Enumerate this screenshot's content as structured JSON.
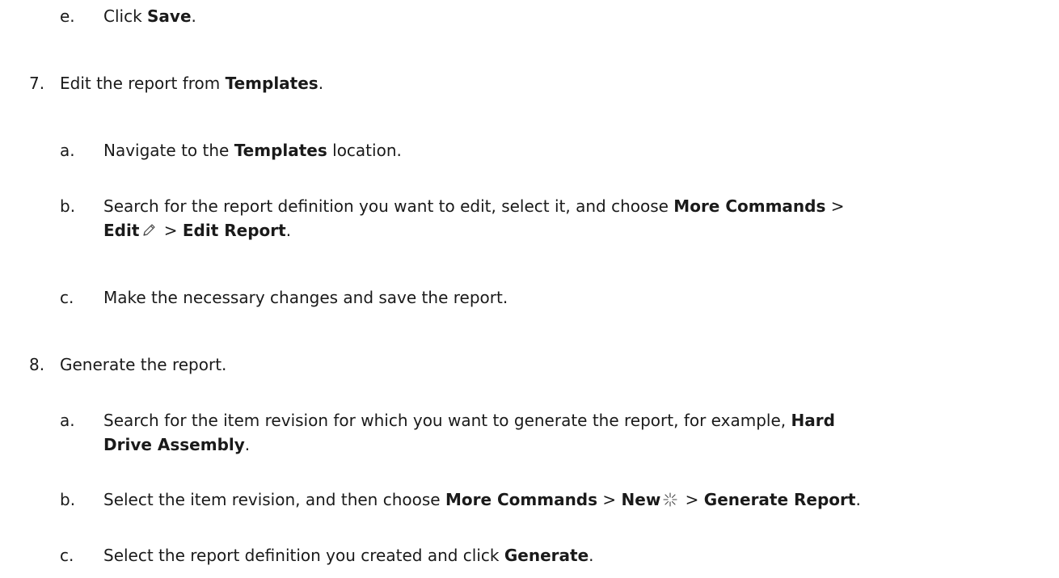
{
  "steps": {
    "step6": {
      "sub_e": {
        "marker": "e.",
        "t1": "Click ",
        "save": "Save",
        "t2": "."
      }
    },
    "step7": {
      "marker": "7.",
      "t1": "Edit the report from ",
      "templates": "Templates",
      "t2": ".",
      "sub_a": {
        "marker": "a.",
        "t1": "Navigate to the ",
        "templates": "Templates",
        "t2": " location."
      },
      "sub_b": {
        "marker": "b.",
        "t1": "Search for the report definition you want to edit, select it, and choose ",
        "more_commands": "More Commands",
        "sep1": " >",
        "edit": "Edit",
        "sep2": " > ",
        "edit_report": "Edit Report",
        "t2": "."
      },
      "sub_c": {
        "marker": "c.",
        "text": "Make the necessary changes and save the report."
      }
    },
    "step8": {
      "marker": "8.",
      "text": "Generate the report.",
      "sub_a": {
        "marker": "a.",
        "t1": "Search for the item revision for which you want to generate the report, for example, ",
        "hard": "Hard",
        "drive_assembly": "Drive Assembly",
        "t2": "."
      },
      "sub_b": {
        "marker": "b.",
        "t1": "Select the item revision, and then choose ",
        "more_commands": "More Commands",
        "sep1": " > ",
        "new": "New",
        "sep2": " > ",
        "generate_report": "Generate Report",
        "t2": "."
      },
      "sub_c": {
        "marker": "c.",
        "t1": "Select the report definition you created and click ",
        "generate": "Generate",
        "t2": "."
      }
    }
  },
  "icons": {
    "edit": "pencil-edit-icon",
    "new": "sparkle-new-icon"
  }
}
